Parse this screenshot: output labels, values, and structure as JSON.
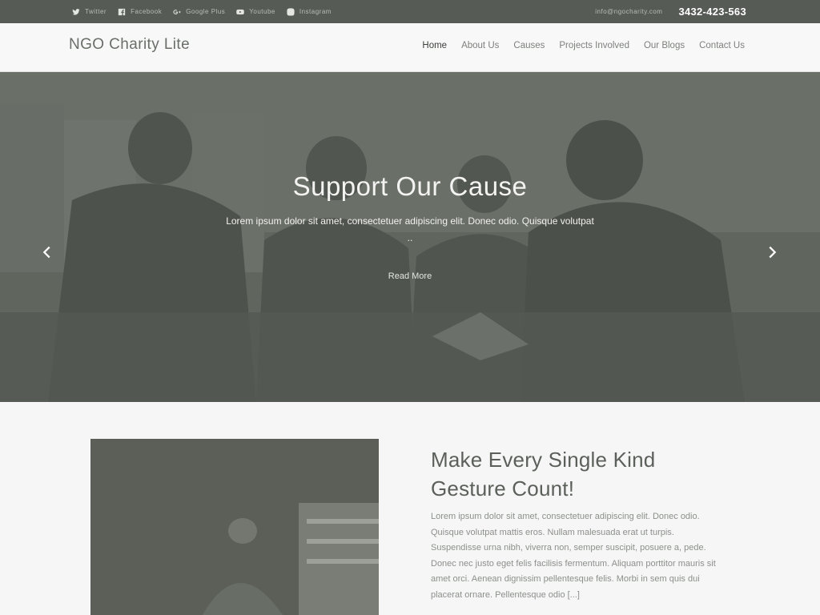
{
  "topbar": {
    "social": [
      {
        "icon": "twitter-icon",
        "label": "Twitter"
      },
      {
        "icon": "facebook-icon",
        "label": "Facebook"
      },
      {
        "icon": "google-plus-icon",
        "label": "Google Plus"
      },
      {
        "icon": "youtube-icon",
        "label": "Youtube"
      },
      {
        "icon": "instagram-icon",
        "label": "Instagram"
      }
    ],
    "email": "info@ngocharity.com",
    "phone": "3432-423-563"
  },
  "header": {
    "logo": "NGO Charity Lite",
    "nav": [
      "Home",
      "About Us",
      "Causes",
      "Projects Involved",
      "Our Blogs",
      "Contact Us"
    ],
    "active_nav": "Home"
  },
  "hero": {
    "title": "Support Our Cause",
    "subtitle": "Lorem ipsum dolor sit amet, consectetuer adipiscing elit. Donec odio. Quisque volutpat ..",
    "button": "Read More"
  },
  "intro": {
    "heading": "Make Every Single Kind Gesture Count!",
    "text": "Lorem ipsum dolor sit amet, consectetuer adipiscing elit. Donec odio. Quisque volutpat mattis eros. Nullam malesuada erat ut turpis. Suspendisse urna nibh, viverra non, semper suscipit, posuere a, pede. Donec nec justo eget felis facilisis fermentum. Aliquam porttitor mauris sit amet orci. Aenean dignissim pellentesque felis. Morbi in sem quis dui placerat ornare. Pellentesque odio [...]"
  },
  "colors": {
    "topbar_bg": "#575b56",
    "hero_overlay": "#62665f",
    "text_dark": "#5c605b",
    "text_muted": "#8c908b"
  }
}
